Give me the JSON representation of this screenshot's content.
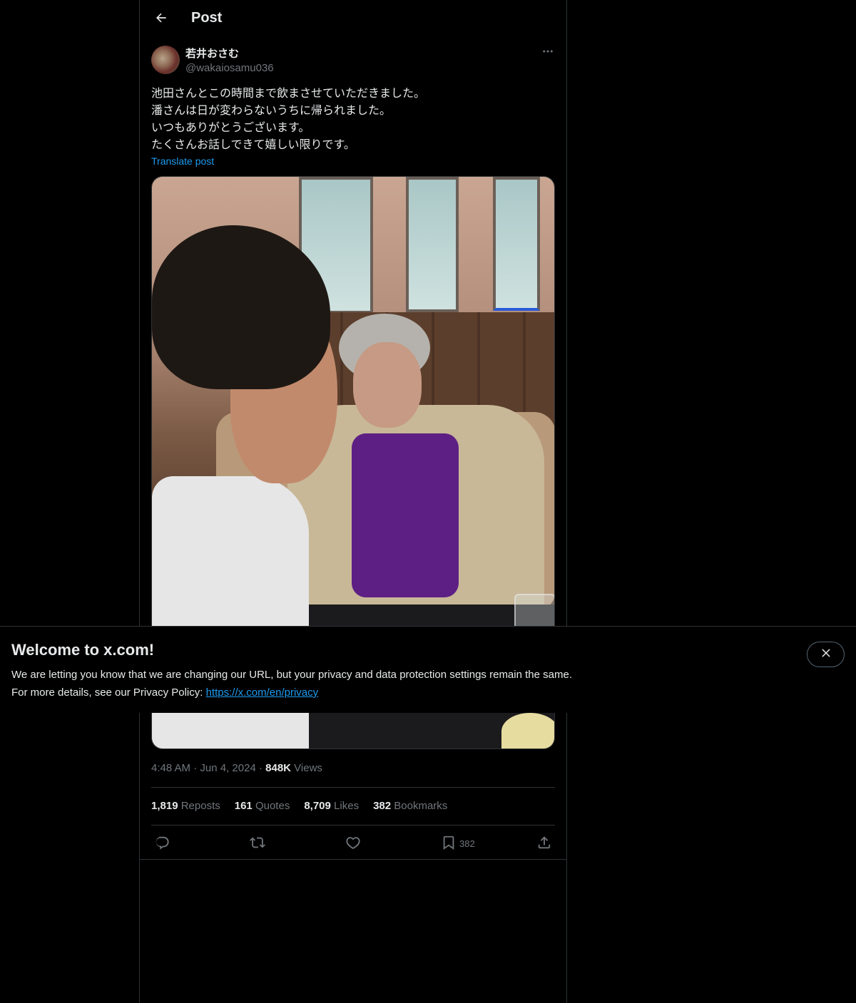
{
  "header": {
    "title": "Post"
  },
  "author": {
    "display_name": "若井おさむ",
    "handle": "@wakaiosamu036"
  },
  "post": {
    "text": "池田さんとこの時間まで飲まさせていただきました。\n潘さんは日が変わらないうちに帰られました。\nいつもありがとうございます。\nたくさんお話しできて嬉しい限りです。",
    "translate_label": "Translate post"
  },
  "meta": {
    "time": "4:48 AM",
    "separator": "·",
    "date": "Jun 4, 2024",
    "views_count": "848K",
    "views_label": "Views"
  },
  "stats": {
    "reposts": {
      "count": "1,819",
      "label": "Reposts"
    },
    "quotes": {
      "count": "161",
      "label": "Quotes"
    },
    "likes": {
      "count": "8,709",
      "label": "Likes"
    },
    "bookmarks": {
      "count": "382",
      "label": "Bookmarks"
    }
  },
  "actions": {
    "bookmark_count": "382"
  },
  "banner": {
    "title": "Welcome to x.com!",
    "line1": "We are letting you know that we are changing our URL, but your privacy and data protection settings remain the same.",
    "line2_prefix": "For more details, see our Privacy Policy: ",
    "link": "https://x.com/en/privacy"
  },
  "icons": {
    "back": "arrow-left-icon",
    "more": "more-horizontal-icon",
    "reply": "reply-icon",
    "repost": "repost-icon",
    "like": "heart-icon",
    "bookmark": "bookmark-icon",
    "share": "share-icon",
    "close": "close-icon"
  },
  "colors": {
    "background": "#000000",
    "text": "#e7e9ea",
    "muted": "#71767b",
    "accent": "#1d9bf0",
    "border": "#2f3336"
  }
}
